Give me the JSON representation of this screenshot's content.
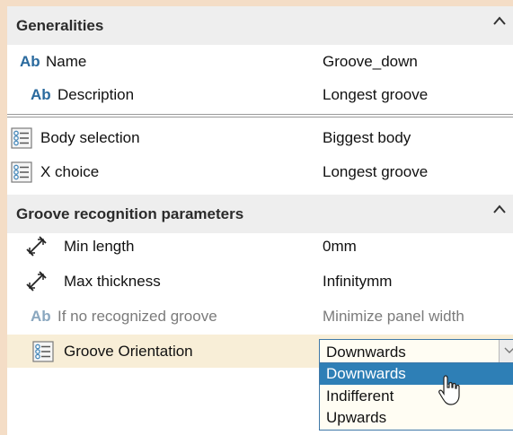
{
  "generalities": {
    "title": "Generalities",
    "rows": [
      {
        "icon": "text-ab-icon",
        "icon_text": "Ab",
        "label": "Name",
        "value": "Groove_down"
      },
      {
        "icon": "text-ab-icon",
        "icon_text": "Ab",
        "label": "Description",
        "value": "Longest groove"
      }
    ]
  },
  "selection_rows": [
    {
      "icon": "list-icon",
      "label": "Body selection",
      "value": "Biggest body"
    },
    {
      "icon": "list-icon",
      "label": "X choice",
      "value": "Longest groove"
    }
  ],
  "groove_params": {
    "title": "Groove recognition parameters",
    "rows": [
      {
        "icon": "length-measure-icon",
        "label": "Min length",
        "value": "0mm"
      },
      {
        "icon": "length-measure-icon",
        "label": "Max thickness",
        "value": "Infinitymm"
      },
      {
        "icon": "text-ab-icon",
        "icon_text": "Ab",
        "label": "If no recognized groove",
        "value": "Minimize panel width"
      }
    ],
    "orientation": {
      "icon": "list-icon",
      "label": "Groove Orientation",
      "value": "Downwards",
      "options": [
        "Downwards",
        "Indifferent",
        "Upwards"
      ],
      "highlighted_option": "Downwards"
    }
  },
  "colors": {
    "frame": "#f4ddc6",
    "header_bg": "#eeeeee",
    "accent_blue": "#2a6a9e",
    "selected_bg": "#2e7fb6",
    "highlight_row": "#f8eed7"
  }
}
